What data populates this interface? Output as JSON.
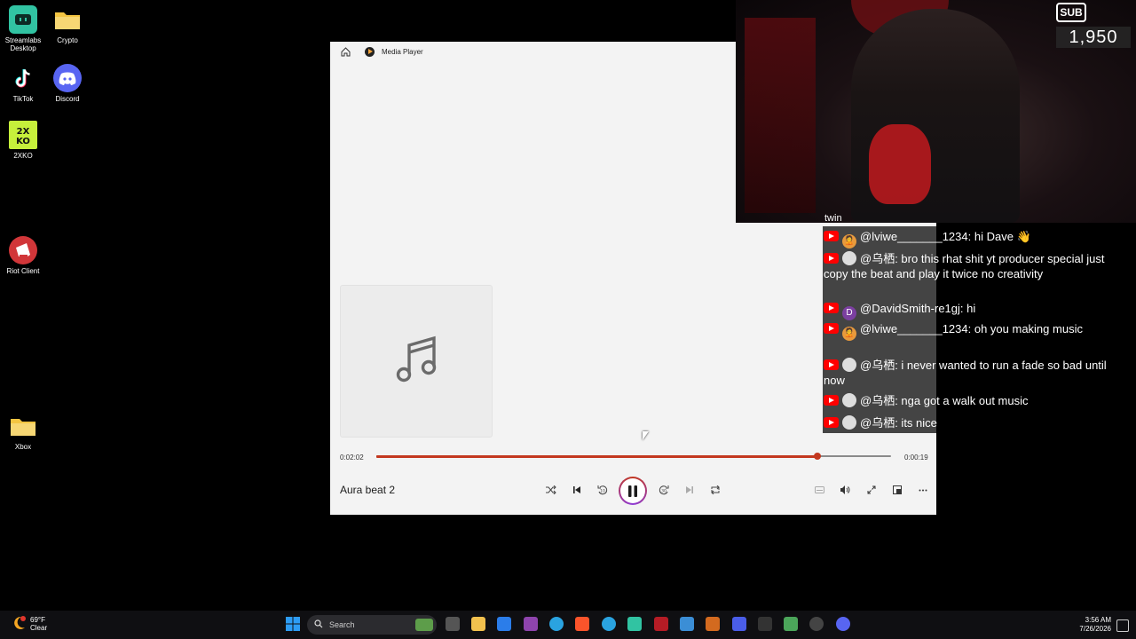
{
  "desktop": {
    "icons": [
      {
        "label": "Streamlabs Desktop",
        "icon": "streamlabs-icon",
        "color": "#31c3a2"
      },
      {
        "label": "Crypto",
        "icon": "folder-icon",
        "color": "#f4c542"
      },
      {
        "label": "TikTok",
        "icon": "tiktok-icon",
        "color": "#000000"
      },
      {
        "label": "Discord",
        "icon": "discord-icon",
        "color": "#5865f2"
      },
      {
        "label": "2XKO",
        "icon": "2xko-icon",
        "color": "#c6f03b"
      },
      {
        "label": "Riot Client",
        "icon": "riot-icon",
        "color": "#d13639"
      },
      {
        "label": "Xbox",
        "icon": "folder-icon",
        "color": "#f4c542"
      }
    ]
  },
  "player": {
    "app_title": "Media Player",
    "track_title": "Aura beat 2",
    "elapsed": "0:02:02",
    "remaining": "0:00:19",
    "progress_fraction": 0.857,
    "accent": "#c3381f"
  },
  "stream": {
    "sub_badge": "SUB",
    "sub_count": "1,950",
    "caption": "twin"
  },
  "chat": {
    "messages": [
      {
        "user": "@lviwe_______1234:",
        "text": " hi Dave 👋",
        "avatar": "avatar-lviwe"
      },
      {
        "user": "@乌栖:",
        "text": " bro this rhat shit yt producer special just copy the beat and play it twice no creativity",
        "avatar": "avatar-wuqi"
      },
      {
        "user": "@DavidSmith-re1gj:",
        "text": " hi",
        "avatar": "avatar-D"
      },
      {
        "user": "@lviwe_______1234:",
        "text": " oh you making music",
        "avatar": "avatar-lviwe"
      },
      {
        "user": "@乌栖:",
        "text": " i never wanted to run a fade so bad until now",
        "avatar": "avatar-wuqi"
      },
      {
        "user": "@乌栖:",
        "text": " nga got a walk out music",
        "avatar": "avatar-wuqi"
      },
      {
        "user": "@乌栖:",
        "text": " its nice",
        "avatar": "avatar-wuqi"
      }
    ],
    "avatar_letter": "D"
  },
  "taskbar": {
    "temperature": "69°F",
    "condition": "Clear",
    "search_placeholder": "Search",
    "time": "3:56 AM",
    "date": "7/26/2026"
  }
}
